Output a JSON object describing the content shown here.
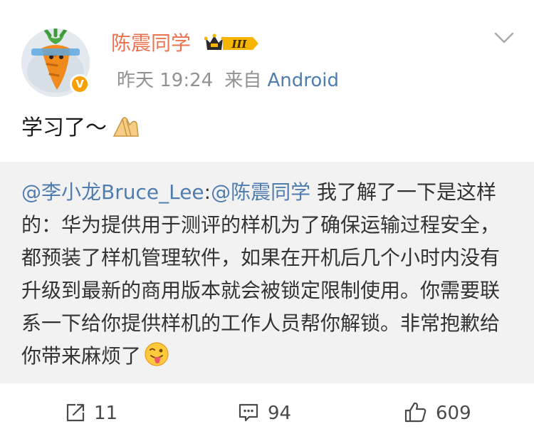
{
  "post": {
    "username": "陈震同学",
    "level_badge": "III",
    "time": "昨天 19:24",
    "source_prefix": "来自",
    "source": "Android",
    "text": "学习了～",
    "emoji": "hands-together"
  },
  "repost": {
    "mention_author": "@李小龙Bruce_Lee",
    "separator": ":",
    "mention_reply": "@陈震同学",
    "text": " 我了解了一下是这样的：华为提供用于测评的样机为了确保运输过程安全，都预装了样机管理软件，如果在开机后几个小时内没有升级到最新的商用版本就会被锁定限制使用。你需要联系一下给你提供样机的工作人员帮你解锁。非常抱歉给你带来麻烦了",
    "emoji": "tongue-out-face"
  },
  "actions": {
    "repost_count": "11",
    "comment_count": "94",
    "like_count": "609"
  },
  "colors": {
    "username": "#eb7350",
    "link": "#507daf",
    "meta": "#929292",
    "repost_bg": "#f2f2f2"
  }
}
